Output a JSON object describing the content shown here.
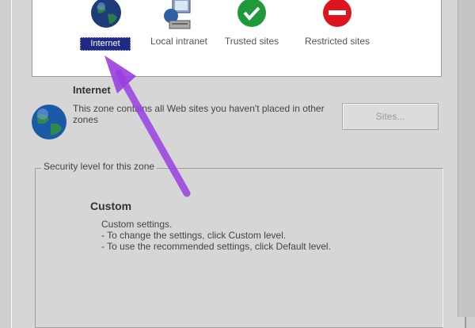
{
  "zones": [
    {
      "label": "Internet",
      "icon": "globe-icon",
      "selected": true
    },
    {
      "label": "Local intranet",
      "icon": "intranet-computer-icon",
      "selected": false
    },
    {
      "label": "Trusted sites",
      "icon": "check-icon",
      "selected": false
    },
    {
      "label": "Restricted sites",
      "icon": "no-entry-icon",
      "selected": false
    }
  ],
  "zone_info": {
    "title": "Internet",
    "description": "This zone contains all Web sites you haven't placed in other zones",
    "sites_button": "Sites..."
  },
  "security_level": {
    "group_label": "Security level for this zone",
    "level_name": "Custom",
    "lines": [
      "Custom settings.",
      "- To change the settings, click Custom level.",
      "- To use the recommended settings, click Default level."
    ]
  },
  "colors": {
    "selection": "#1f2a86",
    "arrow": "#9a3fe0"
  }
}
